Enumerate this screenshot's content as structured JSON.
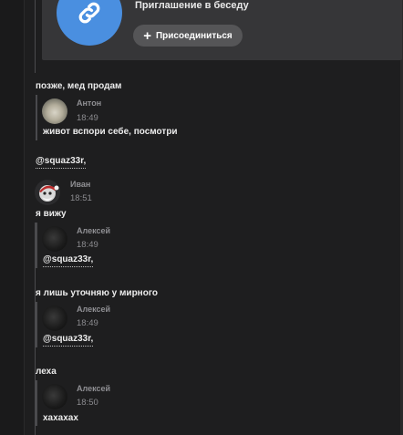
{
  "invite": {
    "title": "Приглашение в беседу",
    "join_label": "Присоединиться",
    "accent": "#4a8fe0"
  },
  "messages": {
    "m1": {
      "text": "позже, мед продам"
    },
    "q1": {
      "author": "Антон",
      "time": "18:49",
      "text": "живот вспори себе, посмотри"
    },
    "m2": {
      "mention": "@squaz33r,"
    },
    "ivan": {
      "author": "Иван",
      "time": "18:51"
    },
    "m3": {
      "text": "я вижу"
    },
    "q2": {
      "author": "Алексей",
      "time": "18:49",
      "mention": "@squaz33r,"
    },
    "m4": {
      "text": "я лишь уточняю у мирного"
    },
    "q3": {
      "author": "Алексей",
      "time": "18:49",
      "mention": "@squaz33r,"
    },
    "m5": {
      "text": "леха"
    },
    "q4": {
      "author": "Алексей",
      "time": "18:50",
      "text": "хахахах"
    }
  }
}
